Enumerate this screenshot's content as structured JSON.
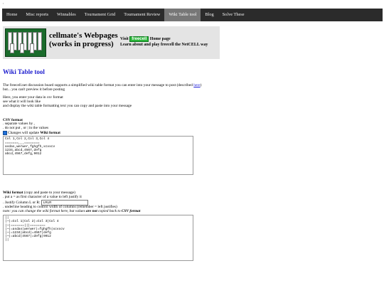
{
  "top_dot": ",",
  "nav": [
    {
      "label": "Home",
      "active": false
    },
    {
      "label": "Misc reports",
      "active": false
    },
    {
      "label": "Winnables",
      "active": false
    },
    {
      "label": "Tournament Grid",
      "active": false
    },
    {
      "label": "Tournament Review",
      "active": false
    },
    {
      "label": "Wiki Table tool",
      "active": true
    },
    {
      "label": "Blog",
      "active": false
    },
    {
      "label": "Solve These",
      "active": false
    }
  ],
  "banner": {
    "title": "cellmate's Webpages (works in progress)",
    "visit_prefix": "Visit",
    "freecell_logo": "freecell",
    "visit_suffix": "Home page",
    "learn": "Learn about and play freecell the NetCELL way"
  },
  "page_title": "Wiki Table tool",
  "intro": {
    "line1": "The freecell.net discussion board supports a simplified wiki table format you can enter into your message to post (described",
    "link": "here",
    "line1_end": ")",
    "line2": "but... you can't preview it before posting"
  },
  "howto": [
    "Here, you enter your data in csv format",
    "see what it will look like",
    "and display the wiki table formatting text you can copy and paste into your message"
  ],
  "csv": {
    "title": "CSV format",
    "rule1": ". separate values by ,",
    "rule2": ". do not put , or | in the values",
    "checkbox_label": "Changes will update",
    "checkbox_bold": "Wiki format",
    "text": "Col 1,Col 2,Col 3,Col 4\n=======,,,========\nasdas,werwer,fghgfh,xcvxcv\n1234,abcd,4567,defg\nabcd,4567,defg,9012"
  },
  "wiki": {
    "title": "Wiki format",
    "title_note": "(copy and paste to your message)",
    "rule1": ". put a = as first character of a value to left justify it",
    "rule2_prefix": ". Justify Column L or R:",
    "justify_value": "LRLR",
    "rule3": ". underline heading to control width of columns (remember = left justifies)",
    "note_prefix": "note: you can change the wiki format here, but values",
    "note_are_not": "are not",
    "note_middle": "copied back to",
    "note_csv": "CSV format",
    "text": "||\n|~|=Col 1|Col 2|=Col 3|Col 4\n|~|=======|||========\n|~|=asdas|werwer|=fghgfh|xcvxcv\n|~|=1234|abcd|=4567|defg\n|~|=abcd|4567|=defg|9012\n||"
  }
}
